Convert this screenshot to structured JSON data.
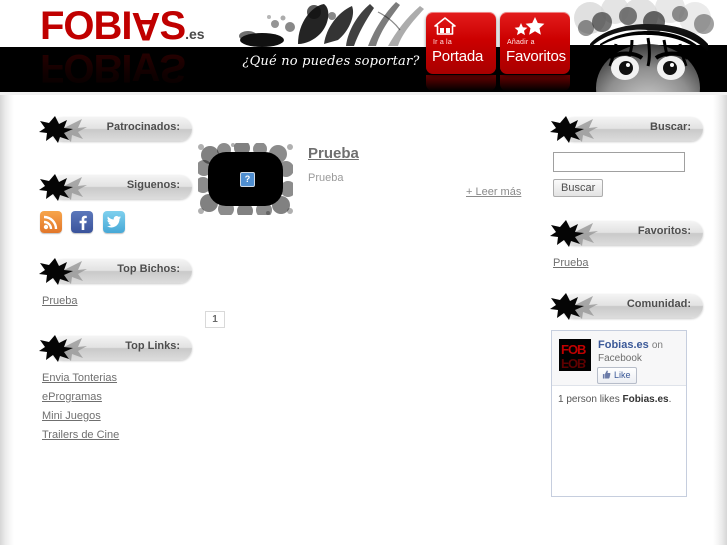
{
  "header": {
    "logo": {
      "text_before": "FOBI",
      "flipped_letter": "A",
      "text_after": "S",
      "suffix": ".es"
    },
    "tagline": "¿Qué no puedes soportar?",
    "buttons": [
      {
        "name": "home",
        "sub": "Ir a la",
        "main": "Portada",
        "icon": "home-icon"
      },
      {
        "name": "favorites",
        "sub": "Añadir a",
        "main": "Favoritos",
        "icon": "stars-icon"
      }
    ],
    "accent_color": "#cc0000"
  },
  "sidebar_left": {
    "sections": [
      {
        "title": "Patrocinados:",
        "items": []
      },
      {
        "title": "Siguenos:",
        "items": []
      },
      {
        "title": "Top Bichos:",
        "items": [
          "Prueba"
        ]
      },
      {
        "title": "Top Links:",
        "items": [
          "Envia Tonterias",
          "eProgramas",
          "Mini Juegos",
          "Trailers de Cine"
        ]
      }
    ],
    "social": [
      {
        "name": "rss-icon",
        "label": "RSS",
        "color": "#e2762a"
      },
      {
        "name": "facebook-icon",
        "label": "Facebook",
        "color": "#3a539b"
      },
      {
        "name": "twitter-icon",
        "label": "Twitter",
        "color": "#46a8d6"
      }
    ],
    "top_bichos": {
      "title": "Top Bichos:",
      "links": [
        "Prueba"
      ]
    },
    "top_links": {
      "title": "Top Links:",
      "links": [
        "Envia Tonterias",
        "eProgramas",
        "Mini Juegos",
        "Trailers de Cine"
      ]
    },
    "patrocinados_title": "Patrocinados:",
    "siguenos_title": "Siguenos:"
  },
  "main": {
    "post": {
      "title": "Prueba",
      "excerpt": "Prueba",
      "read_more": "+ Leer más",
      "thumbnail_state": "broken-image",
      "broken_glyph": "?"
    },
    "pagination": {
      "pages": [
        "1"
      ],
      "current": "1"
    }
  },
  "sidebar_right": {
    "search": {
      "title": "Buscar:",
      "value": "",
      "placeholder": "",
      "button_label": "Buscar"
    },
    "favorites": {
      "title": "Favoritos:",
      "links": [
        "Prueba"
      ]
    },
    "community": {
      "title": "Comunidad:",
      "facebook": {
        "page_name": "Fobias.es",
        "on_word": "on",
        "network": "Facebook",
        "like_label": "Like",
        "likes_text_prefix": "1 person likes ",
        "likes_text_name": "Fobias.es",
        "likes_text_suffix": ".",
        "thumb_text_top": "FOB",
        "thumb_text_bottom": "FOB"
      }
    }
  }
}
